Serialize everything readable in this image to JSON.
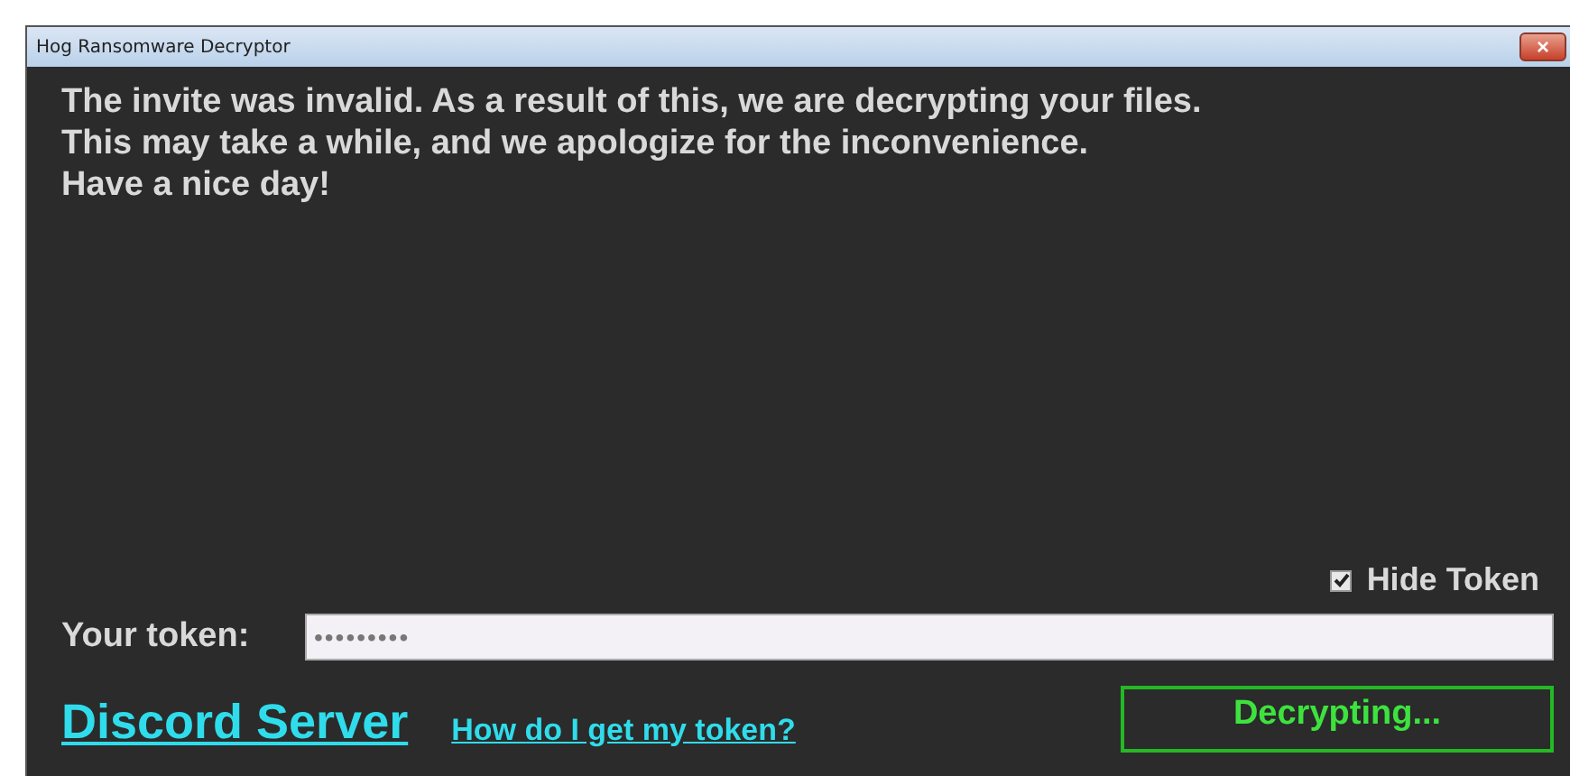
{
  "window": {
    "title": "Hog Ransomware Decryptor",
    "close": "×"
  },
  "message": [
    "The invite was invalid. As a result of this, we are decrypting your files.",
    "This may take a while, and we apologize for the inconvenience.",
    "Have a nice day!"
  ],
  "hide_token": {
    "label": "Hide Token",
    "checked": true
  },
  "token": {
    "label": "Your token:",
    "value": "•••••••••"
  },
  "links": [
    {
      "kind": "large",
      "text": "Discord Server"
    },
    {
      "kind": "small",
      "text": "How do I get my token?"
    }
  ],
  "decrypt_button": {
    "label": "Decrypting..."
  }
}
